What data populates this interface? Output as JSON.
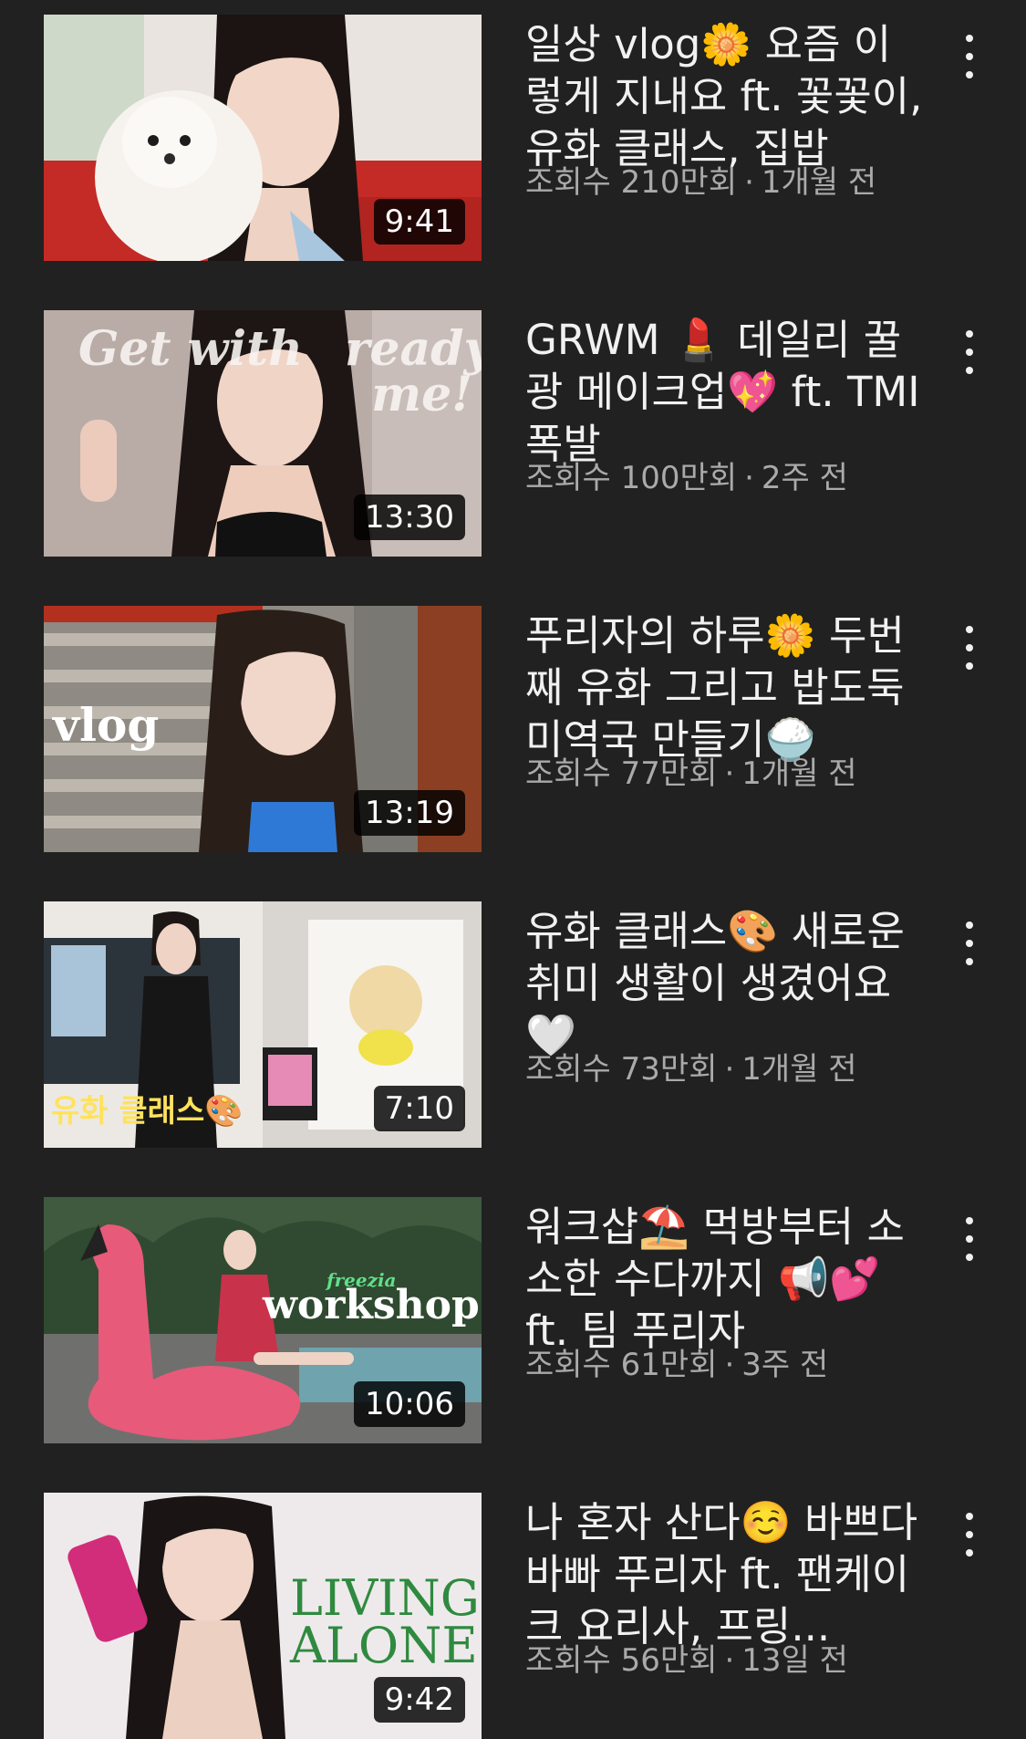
{
  "videos": [
    {
      "title": "일상 vlog🌼 요즘 이렇게 지내요 ft. 꽃꽃이, 유화 클래스, 집밥",
      "views": "조회수 210만회",
      "age": "1개월 전",
      "duration": "9:41",
      "thumb_icon": "woman-with-white-dog-thumbnail"
    },
    {
      "title": "GRWM 💄 데일리 꿀광 메이크업💖 ft. TMI 폭발",
      "views": "조회수 100만회",
      "age": "2주 전",
      "duration": "13:30",
      "thumb_text_left": "Get with",
      "thumb_text_right": "ready me!",
      "thumb_icon": "get-ready-with-me-thumbnail"
    },
    {
      "title": "푸리자의 하루🌼 두번째 유화 그리고 밥도둑 미역국 만들기🍚",
      "views": "조회수 77만회",
      "age": "1개월 전",
      "duration": "13:19",
      "thumb_text_left": "vlog",
      "thumb_icon": "vlog-stairs-thumbnail"
    },
    {
      "title": "유화 클래스🎨 새로운 취미 생활이 생겼어요🤍",
      "views": "조회수 73만회",
      "age": "1개월 전",
      "duration": "7:10",
      "thumb_text_left": "유화 클래스🎨",
      "thumb_icon": "painting-class-thumbnail"
    },
    {
      "title": "워크샵⛱️ 먹방부터 소소한 수다까지 📢💕 ft. 팀 푸리자",
      "views": "조회수 61만회",
      "age": "3주 전",
      "duration": "10:06",
      "thumb_text_small": "freezia",
      "thumb_text_left": "workshop",
      "thumb_icon": "flamingo-workshop-thumbnail"
    },
    {
      "title": "나 혼자 산다☺️ 바쁘다 바빠 푸리자 ft. 팬케이크 요리사, 프링...",
      "views": "조회수 56만회",
      "age": "13일 전",
      "duration": "9:42",
      "thumb_text_left": "LIVING ALONE",
      "thumb_icon": "living-alone-thumbnail"
    }
  ],
  "colors": {
    "background": "#212121",
    "title": "#f1f1f1",
    "meta": "#aaaaaa"
  }
}
